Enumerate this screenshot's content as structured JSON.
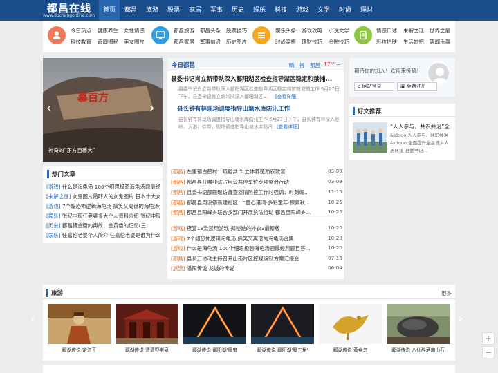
{
  "site": {
    "name": "都昌在线",
    "url": "www.duchangonline.com"
  },
  "nav": [
    "首页",
    "都昌",
    "旅游",
    "股票",
    "家居",
    "军事",
    "历史",
    "娱乐",
    "科技",
    "游戏",
    "文学",
    "时尚",
    "理财"
  ],
  "categories": [
    {
      "icon": "person-icon",
      "color": "#ef7b5a",
      "row1": [
        "今日热点",
        "健康养生",
        "女性情感"
      ],
      "row2": [
        "科技教育",
        "奇闻揭秘",
        "美女图片"
      ]
    },
    {
      "icon": "monitor-icon",
      "color": "#2e9ee0",
      "row1": [
        "都昌旅游",
        "都昌头条",
        "股票技巧"
      ],
      "row2": [
        "都昌家居",
        "军事前沿",
        "历史图片"
      ]
    },
    {
      "icon": "list-icon",
      "color": "#f5a623",
      "row1": [
        "娱乐头条",
        "游戏攻略",
        "小说文学"
      ],
      "row2": [
        "时尚穿搭",
        "理财技巧",
        "金融技巧"
      ]
    },
    {
      "icon": "document-icon",
      "color": "#8cc63f",
      "row1": [
        "情感口述",
        "未解之谜",
        "世界之最"
      ],
      "row2": [
        "彩妆护肤",
        "生活妙招",
        "趣闻乐事"
      ]
    }
  ],
  "slider": {
    "caption": "神奇的“东方百慕大”",
    "sign": "慕百方"
  },
  "hot": {
    "title": "热门文章",
    "items": [
      {
        "tag": "[游戏]",
        "text": "什么是海龟汤 100个细思极恐海龟汤题最经典"
      },
      {
        "tag": "[未解之谜]",
        "text": "女鬼图片最吓人的女鬼图片 日本十大女"
      },
      {
        "tag": "[游戏]",
        "text": "7个超恐怖逻辑海龟汤 搞笑又离谱的海龟汤合"
      },
      {
        "tag": "[娱乐]",
        "text": "张纪中现任老婆多大个人资料介绍 张纪中现"
      },
      {
        "tag": "[历史]",
        "text": "都昌猪金街的典故：金黄色的记忆(三)"
      },
      {
        "tag": "[娱乐]",
        "text": "任嘉伦老婆个人简介 任嘉伦老婆是谁为什么"
      }
    ]
  },
  "today": {
    "title": "今日都昌",
    "weather": {
      "city": "都昌",
      "cond": "晴",
      "temp": "17℃~"
    },
    "h1": "县委书记肖立新带队深入鄱阳湖区检查指导湖区稳定和禁捕...",
    "s1": "县委书记肖立新带队深入鄱阳湖区检查指导湖区稳定和禁捕退捕工作 6月27日下午，县委书记肖立新带队深入鄱阳湖区...",
    "s1more": "[查看详细]",
    "h2": "县长钟有林现场调度指导山塘水库防汛工作",
    "s2": "县长钟有林现场调度指导山塘水库防汛工作 6月27日下午，县长钟有林深入蔡岭、大港、徐埠，现场调度指导山塘水库防汛...",
    "s2more": "[查看详细]",
    "news": [
      {
        "tag": "[都昌]",
        "text": "左里镇白鹤村：鲢鲶共作 立体养殖助农致富",
        "date": "03-09"
      },
      {
        "tag": "[都昌]",
        "text": "都昌县开展非法占用公共停车位专项整治行动",
        "date": "03-09"
      },
      {
        "tag": "[都昌]",
        "text": "县委书记邵殿瑞访督查疫情防控工作时强调：时刻绷...",
        "date": "11-15"
      },
      {
        "tag": "[都昌]",
        "text": "都昌县周溪镇新建社区：“童心港湾·多彩童年·探索秋...",
        "date": "10-25"
      },
      {
        "tag": "[都昌]",
        "text": "都昌县阳峰乡联合多部门开展执法行动 都昌县阳峰乡...",
        "date": "10-25"
      }
    ],
    "news2": [
      {
        "tag": "[游戏]",
        "text": "夜宴18款禁用游戏 揭秘她的外衣3最新版",
        "date": "10-20"
      },
      {
        "tag": "[游戏]",
        "text": "7个超恐怖逻辑海龟汤 搞笑又离谱的海龟汤合集",
        "date": "10-20"
      },
      {
        "tag": "[游戏]",
        "text": "什么是海龟汤 100个细思极恐海龟汤题最经典题目答...",
        "date": "10-20"
      },
      {
        "tag": "[都昌]",
        "text": "县长万述动主持召开山南片区控规编制方案汇报会",
        "date": "07-18"
      },
      {
        "tag": "[旅游]",
        "text": "潘阳传说 龙城的传说",
        "date": "06-04"
      }
    ]
  },
  "login": {
    "welcome": "期待你的加入！欢迎来投稿！",
    "btn_login": "网站登录",
    "btn_reg": "免费注册"
  },
  "good": {
    "title": "好文推荐",
    "headline": "“人人参与、共识共治”全",
    "text": "&ldquo;人人参与、共识共治&rdquo;全面提升全县城乡人居环境     县委书记..."
  },
  "travel": {
    "title": "旅游",
    "more": "更多",
    "items": [
      "鄱湖传说 定江王",
      "鄱湖传说 清清野老泉",
      "鄱湖传说 鄱阳湖'魔鬼",
      "鄱湖传说 鄱阳湖'魔三角'",
      "鄱湖传说 黄金鸟",
      "鄱湖传说 八仙醉酒南山石"
    ]
  },
  "colors": {
    "nav": "#1a4d8c",
    "accent": "#2a67b0",
    "tag": "#1a6cc6",
    "tagOrange": "#e07020"
  }
}
